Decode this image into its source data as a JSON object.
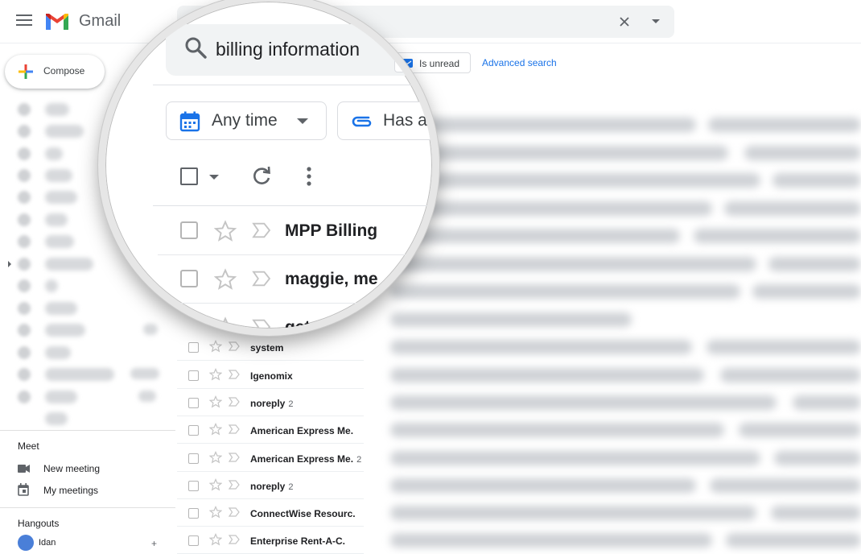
{
  "app": {
    "name": "Gmail"
  },
  "header": {
    "search_query": "billing information"
  },
  "sidebar": {
    "compose_label": "Compose",
    "meet": {
      "title": "Meet",
      "new_meeting": "New meeting",
      "my_meetings": "My meetings"
    },
    "hangouts": {
      "title": "Hangouts",
      "user": "Idan"
    }
  },
  "filters": {
    "is_unread": "Is unread",
    "advanced_search": "Advanced search",
    "any_time": "Any time",
    "has_attachment": "Has a"
  },
  "emails": [
    {
      "sender": "MPP Billing",
      "count": ""
    },
    {
      "sender": "maggie, me",
      "count": ""
    },
    {
      "sender": "getsupp",
      "count": ""
    },
    {
      "sender": "system",
      "count": ""
    },
    {
      "sender": "Igenomix",
      "count": ""
    },
    {
      "sender": "noreply",
      "count": "2"
    },
    {
      "sender": "American Express Me.",
      "count": ""
    },
    {
      "sender": "American Express Me.",
      "count": "2"
    },
    {
      "sender": "noreply",
      "count": "2"
    },
    {
      "sender": "ConnectWise Resourc.",
      "count": ""
    },
    {
      "sender": "Enterprise Rent-A-C.",
      "count": ""
    }
  ],
  "colors": {
    "gmail_red": "#ea4335",
    "gmail_blue": "#4285f4",
    "gmail_yellow": "#fbbc04",
    "gmail_green": "#34a853",
    "link_blue": "#1a73e8",
    "calendar_blue": "#1a73e8"
  },
  "icons": {
    "menu": "menu-icon",
    "search": "search-icon",
    "clear": "close-icon",
    "calendar": "calendar-icon",
    "attachment": "paperclip-icon",
    "refresh": "refresh-icon",
    "more": "more-vertical-icon",
    "star": "star-icon",
    "important": "important-marker-icon",
    "video": "video-camera-icon"
  }
}
